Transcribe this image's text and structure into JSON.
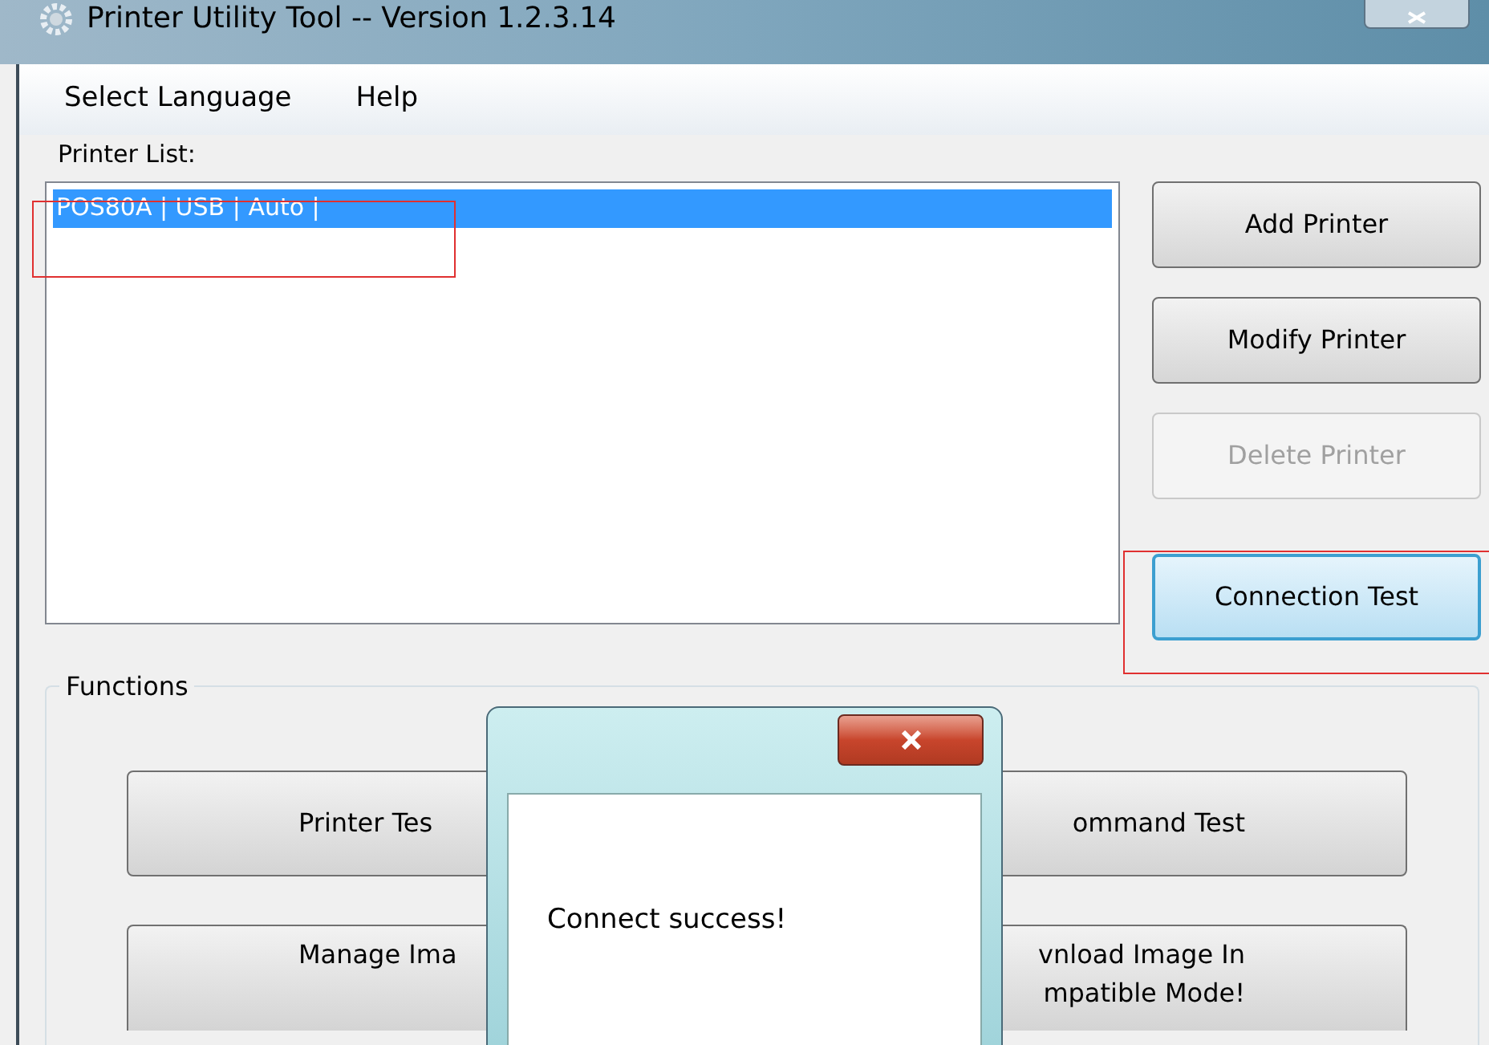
{
  "window": {
    "title": "Printer Utility Tool -- Version 1.2.3.14"
  },
  "menu": [
    "Select Language",
    "Help"
  ],
  "printer_list": {
    "label": "Printer List:",
    "items": [
      {
        "text": "POS80A | USB | Auto |",
        "selected": true
      }
    ]
  },
  "printer_buttons": [
    {
      "label": "Add Printer",
      "disabled": false,
      "focused": false
    },
    {
      "label": "Modify Printer",
      "disabled": false,
      "focused": false
    },
    {
      "label": "Delete Printer",
      "disabled": true,
      "focused": false
    },
    {
      "label": "Connection Test",
      "disabled": false,
      "focused": true
    }
  ],
  "functions": {
    "label": "Functions",
    "buttons": [
      {
        "lines": [
          "Printer Tes"
        ],
        "kind": "left"
      },
      {
        "lines": [
          "ommand Test"
        ],
        "kind": "right"
      },
      {
        "lines": [
          "Manage Ima"
        ],
        "kind": "left"
      },
      {
        "lines": [
          "vnload Image In",
          "mpatible Mode!"
        ],
        "kind": "right"
      }
    ]
  },
  "dialog": {
    "message": "Connect success!"
  }
}
